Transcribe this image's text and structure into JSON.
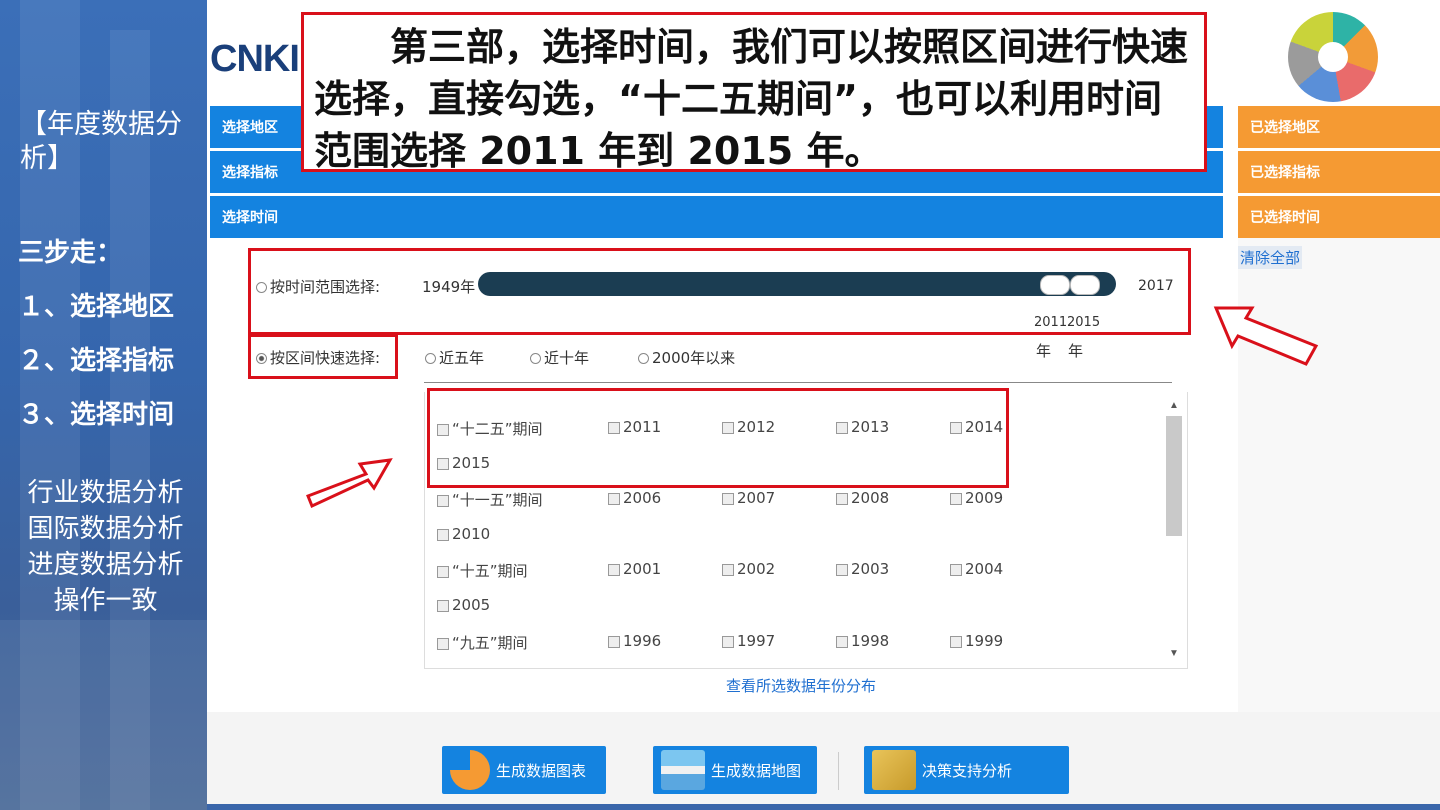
{
  "left_panel": {
    "title": "【年度数据分析】",
    "steps_heading": "三步走：",
    "steps": [
      "１、选择地区",
      "２、选择指标",
      "３、选择时间"
    ],
    "misc": [
      "行业数据分析",
      "国际数据分析",
      "进度数据分析",
      "操作一致"
    ]
  },
  "header": {
    "logo": "CNKI"
  },
  "callout": {
    "text": "第三部，选择时间，我们可以按照区间进行快速选择，直接勾选，“十二五期间”，也可以利用时间范围选择 2011 年到 2015 年。"
  },
  "section_bars": {
    "region": "选择地区",
    "indicator": "选择指标",
    "time": "选择时间"
  },
  "side_bars": {
    "region": "已选择地区",
    "indicator": "已选择指标",
    "time": "已选择时间",
    "clear_all": "清除全部"
  },
  "time_range": {
    "label": "按时间范围选择:",
    "start_label": "1949年",
    "end_label": "2017",
    "selected_start": "2011",
    "selected_end": "2015",
    "unit_start": "年",
    "unit_end": "年"
  },
  "quick_select": {
    "label": "按区间快速选择:",
    "options": [
      "近五年",
      "近十年",
      "2000年以来"
    ]
  },
  "period_list": {
    "rows": [
      {
        "period": "“十二五”期间",
        "years": [
          "2011",
          "2012",
          "2013",
          "2014",
          "2015"
        ]
      },
      {
        "period": "“十一五”期间",
        "years": [
          "2006",
          "2007",
          "2008",
          "2009",
          "2010"
        ]
      },
      {
        "period": "“十五”期间",
        "years": [
          "2001",
          "2002",
          "2003",
          "2004",
          "2005"
        ]
      },
      {
        "period": "“九五”期间",
        "years": [
          "1996",
          "1997",
          "1998",
          "1999"
        ]
      }
    ]
  },
  "link": {
    "view_distribution": "查看所选数据年份分布"
  },
  "bottom_buttons": {
    "chart": "生成数据图表",
    "map": "生成数据地图",
    "decision": "决策支持分析"
  },
  "colors": {
    "blue_bar": "#1483e0",
    "orange_bar": "#f59a33",
    "highlight_red": "#d9101a",
    "slider": "#1b3d52"
  }
}
